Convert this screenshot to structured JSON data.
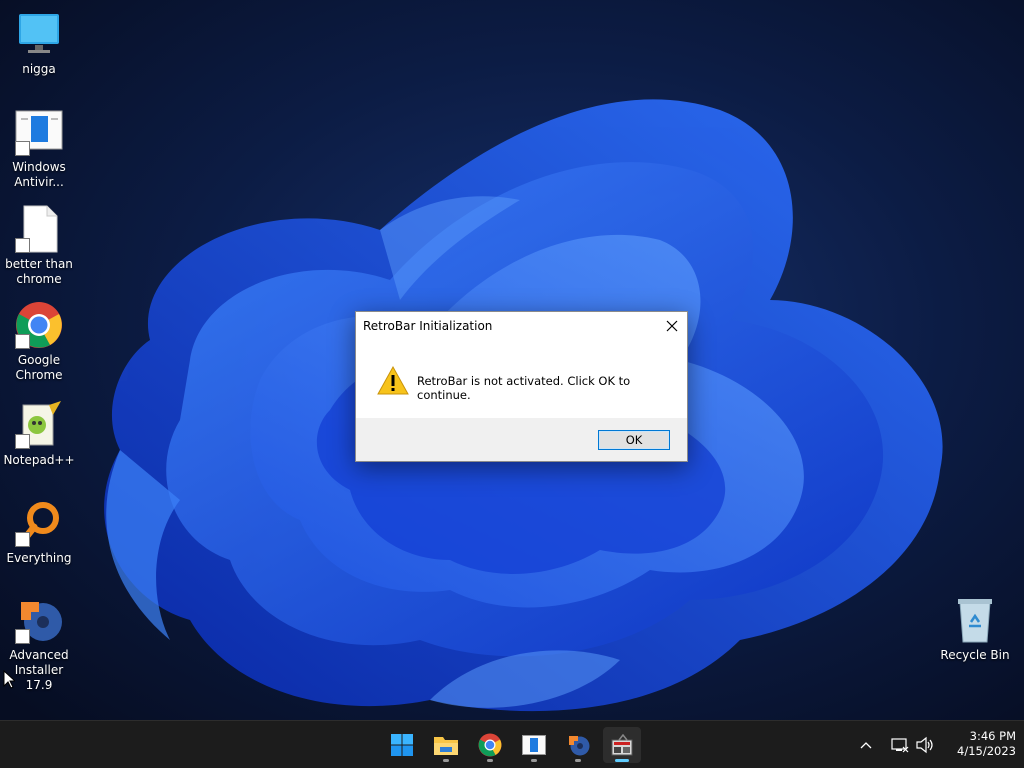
{
  "desktop": {
    "icons": [
      {
        "label": "nigga",
        "icon": "monitor-icon"
      },
      {
        "label": "Windows Antivir...",
        "icon": "windows-antivirus-icon"
      },
      {
        "label": "better than chrome",
        "icon": "text-file-icon"
      },
      {
        "label": "Google Chrome",
        "icon": "chrome-icon"
      },
      {
        "label": "Notepad++",
        "icon": "notepad-plus-plus-icon"
      },
      {
        "label": "Everything",
        "icon": "everything-search-icon"
      },
      {
        "label": "Advanced Installer 17.9",
        "icon": "advanced-installer-icon"
      }
    ],
    "recycle_bin": {
      "label": "Recycle Bin",
      "icon": "recycle-bin-icon"
    }
  },
  "dialog": {
    "title": "RetroBar Initialization",
    "message": "RetroBar is not activated. Click OK to continue.",
    "ok_label": "OK",
    "icon": "warning-icon"
  },
  "taskbar": {
    "apps": [
      {
        "name": "start-button",
        "icon": "windows-logo-icon"
      },
      {
        "name": "file-explorer",
        "icon": "folder-icon"
      },
      {
        "name": "chrome",
        "icon": "chrome-icon"
      },
      {
        "name": "windows-antivirus",
        "icon": "windows-antivirus-icon"
      },
      {
        "name": "advanced-installer",
        "icon": "advanced-installer-icon"
      },
      {
        "name": "retrobar",
        "icon": "retrobar-icon"
      }
    ],
    "tray": {
      "icons": [
        "chevron-up-icon",
        "network-icon",
        "volume-icon"
      ]
    },
    "clock": {
      "time": "3:46 PM",
      "date": "4/15/2023"
    }
  },
  "colors": {
    "accent": "#0078d4",
    "taskbar_bg": "#1c1c1c",
    "wallpaper_dark": "#0b1530",
    "wallpaper_bloom": "#1f5cf0",
    "active_indicator": "#60cdff"
  }
}
